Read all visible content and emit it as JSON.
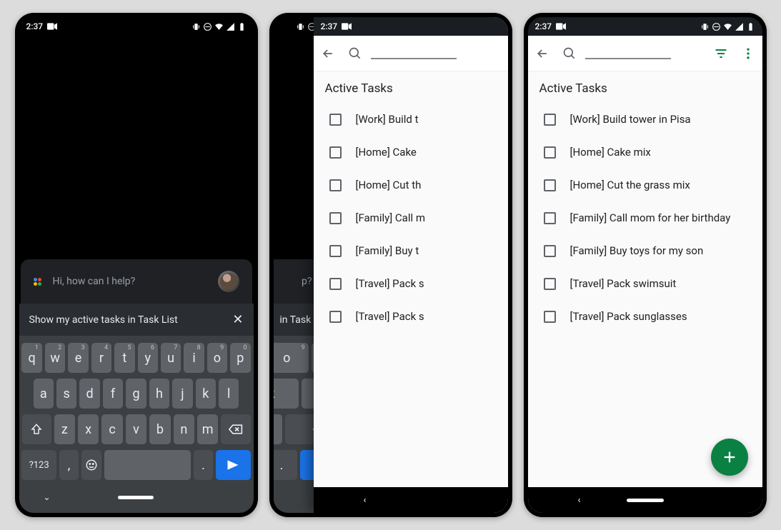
{
  "status": {
    "time": "2:37",
    "icons": [
      "video",
      "vibrate",
      "dnd",
      "wifi",
      "signal",
      "battery"
    ]
  },
  "assistant": {
    "prompt": "Hi, how can I help?",
    "input_text": "Show my active tasks in Task List",
    "input_text_short": "in Task List",
    "help_short": "p?"
  },
  "keyboard": {
    "row1": [
      {
        "k": "q",
        "n": "1"
      },
      {
        "k": "w",
        "n": "2"
      },
      {
        "k": "e",
        "n": "3"
      },
      {
        "k": "r",
        "n": "4"
      },
      {
        "k": "t",
        "n": "5"
      },
      {
        "k": "y",
        "n": "6"
      },
      {
        "k": "u",
        "n": "7"
      },
      {
        "k": "i",
        "n": "8"
      },
      {
        "k": "o",
        "n": "9"
      },
      {
        "k": "p",
        "n": "0"
      }
    ],
    "row2": [
      "a",
      "s",
      "d",
      "f",
      "g",
      "h",
      "j",
      "k",
      "l"
    ],
    "row3": [
      "z",
      "x",
      "c",
      "v",
      "b",
      "n",
      "m"
    ],
    "sym": "?123",
    "comma": ",",
    "period": "."
  },
  "tasks": {
    "section_title": "Active Tasks",
    "items": [
      "[Work] Build tower in Pisa",
      "[Home] Cake mix",
      "[Home] Cut the grass mix",
      "[Family] Call mom for her birthday",
      "[Family] Buy toys for my son",
      "[Travel] Pack swimsuit",
      "[Travel] Pack sunglasses"
    ],
    "items_clipped": [
      "[Work] Build t",
      "[Home] Cake",
      "[Home] Cut th",
      "[Family] Call m",
      "[Family] Buy t",
      "[Travel] Pack s",
      "[Travel] Pack s"
    ]
  }
}
